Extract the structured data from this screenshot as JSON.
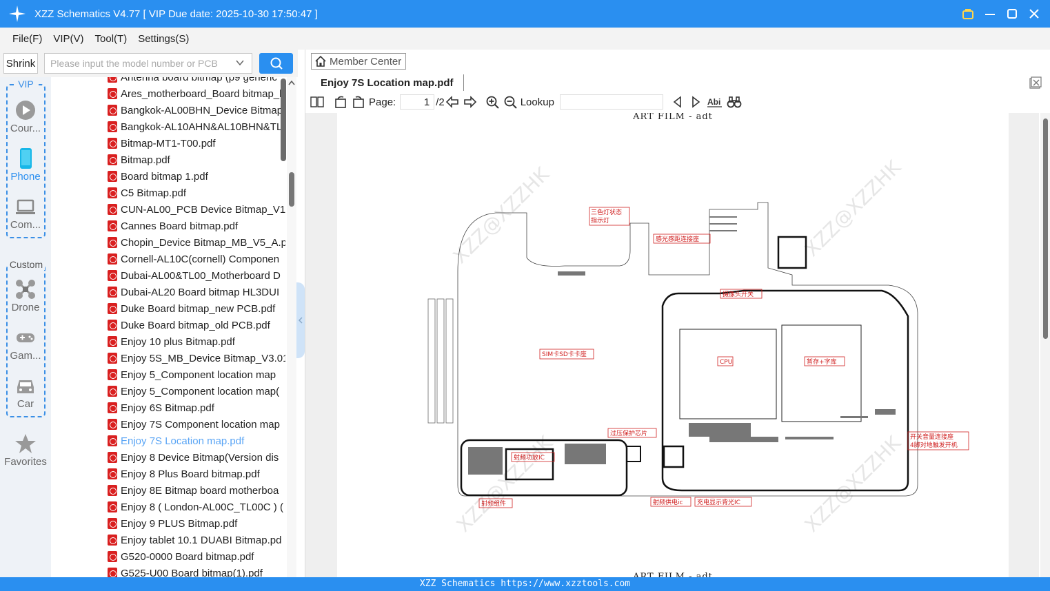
{
  "app": {
    "title": "XZZ Schematics V4.77 [ VIP Due date: 2025-10-30 17:50:47 ]"
  },
  "menu": [
    "File(F)",
    "VIP(V)",
    "Tool(T)",
    "Settings(S)"
  ],
  "search": {
    "shrink_label": "Shrink",
    "placeholder": "Please input the model number or PCB"
  },
  "categories": {
    "vip_label": "VIP",
    "custom_label": "Custom",
    "items": [
      "Cour...",
      "Phone",
      "Com...",
      "Drone",
      "Gam...",
      "Car",
      "Favorites"
    ]
  },
  "files": [
    "Antenna board bitmap (p9 generic",
    "Ares_motherboard_Board bitmap_l",
    "Bangkok-AL00BHN_Device Bitmap",
    "Bangkok-AL10AHN&AL10BHN&TL",
    "Bitmap-MT1-T00.pdf",
    "Bitmap.pdf",
    "Board bitmap 1.pdf",
    "C5 Bitmap.pdf",
    "CUN-AL00_PCB Device Bitmap_V1.",
    "Cannes Board bitmap.pdf",
    "Chopin_Device Bitmap_MB_V5_A.p",
    "Cornell-AL10C(cornell) Componen",
    "Dubai-AL00&TL00_Motherboard D",
    "Dubai-AL20 Board bitmap HL3DUI",
    "Duke Board bitmap_new PCB.pdf",
    "Duke Board bitmap_old PCB.pdf",
    "Enjoy 10 plus Bitmap.pdf",
    "Enjoy 5S_MB_Device Bitmap_V3.01",
    "Enjoy 5_Component location map",
    "Enjoy 5_Component location map(",
    "Enjoy 6S Bitmap.pdf",
    "Enjoy 7S Component location map",
    "Enjoy 7S Location map.pdf",
    "Enjoy 8 Device Bitmap(Version dis",
    "Enjoy 8 Plus Board bitmap.pdf",
    "Enjoy 8E Bitmap board motherboa",
    "Enjoy 8 ( London-AL00C_TL00C ) (",
    "Enjoy 9 PLUS Bitmap.pdf",
    "Enjoy tablet 10.1 DUABI Bitmap.pd",
    "G520-0000 Board bitmap.pdf",
    "G525-U00 Board bitmap(1).pdf"
  ],
  "selected_file_index": 22,
  "viewer": {
    "member_center": "Member Center",
    "tab_title": "Enjoy 7S Location map.pdf",
    "page_label": "Page:",
    "page_current": "1",
    "page_total": "/2",
    "lookup_label": "Lookup",
    "page_header": "ART FILM - adt"
  },
  "board_labels": {
    "tri_led": "三色灯状态",
    "tri_led2": "指示灯",
    "light_sensor": "感光感距连接座",
    "camera_switch": "摄像头开关",
    "sim_sd": "SIM卡SD卡卡座",
    "cpu": "CPU",
    "memory": "暂存+字库",
    "overvoltage": "过压保护芯片",
    "rf_pa": "射频功放IC",
    "rf_group": "射频组件",
    "rf_power": "射频供电ic",
    "charge_backlight": "充电显示背光IC",
    "switch_volume": "开关音量连接座",
    "pin4_boot": "4脚对地触发开机"
  },
  "watermark": "XZZ@XZZHK",
  "footer": "XZZ Schematics https://www.xzztools.com",
  "colors": {
    "accent": "#2a8ff0",
    "selected_text": "#5aa5f5",
    "pdf_icon": "#d92020",
    "annotation": "#d02020"
  }
}
